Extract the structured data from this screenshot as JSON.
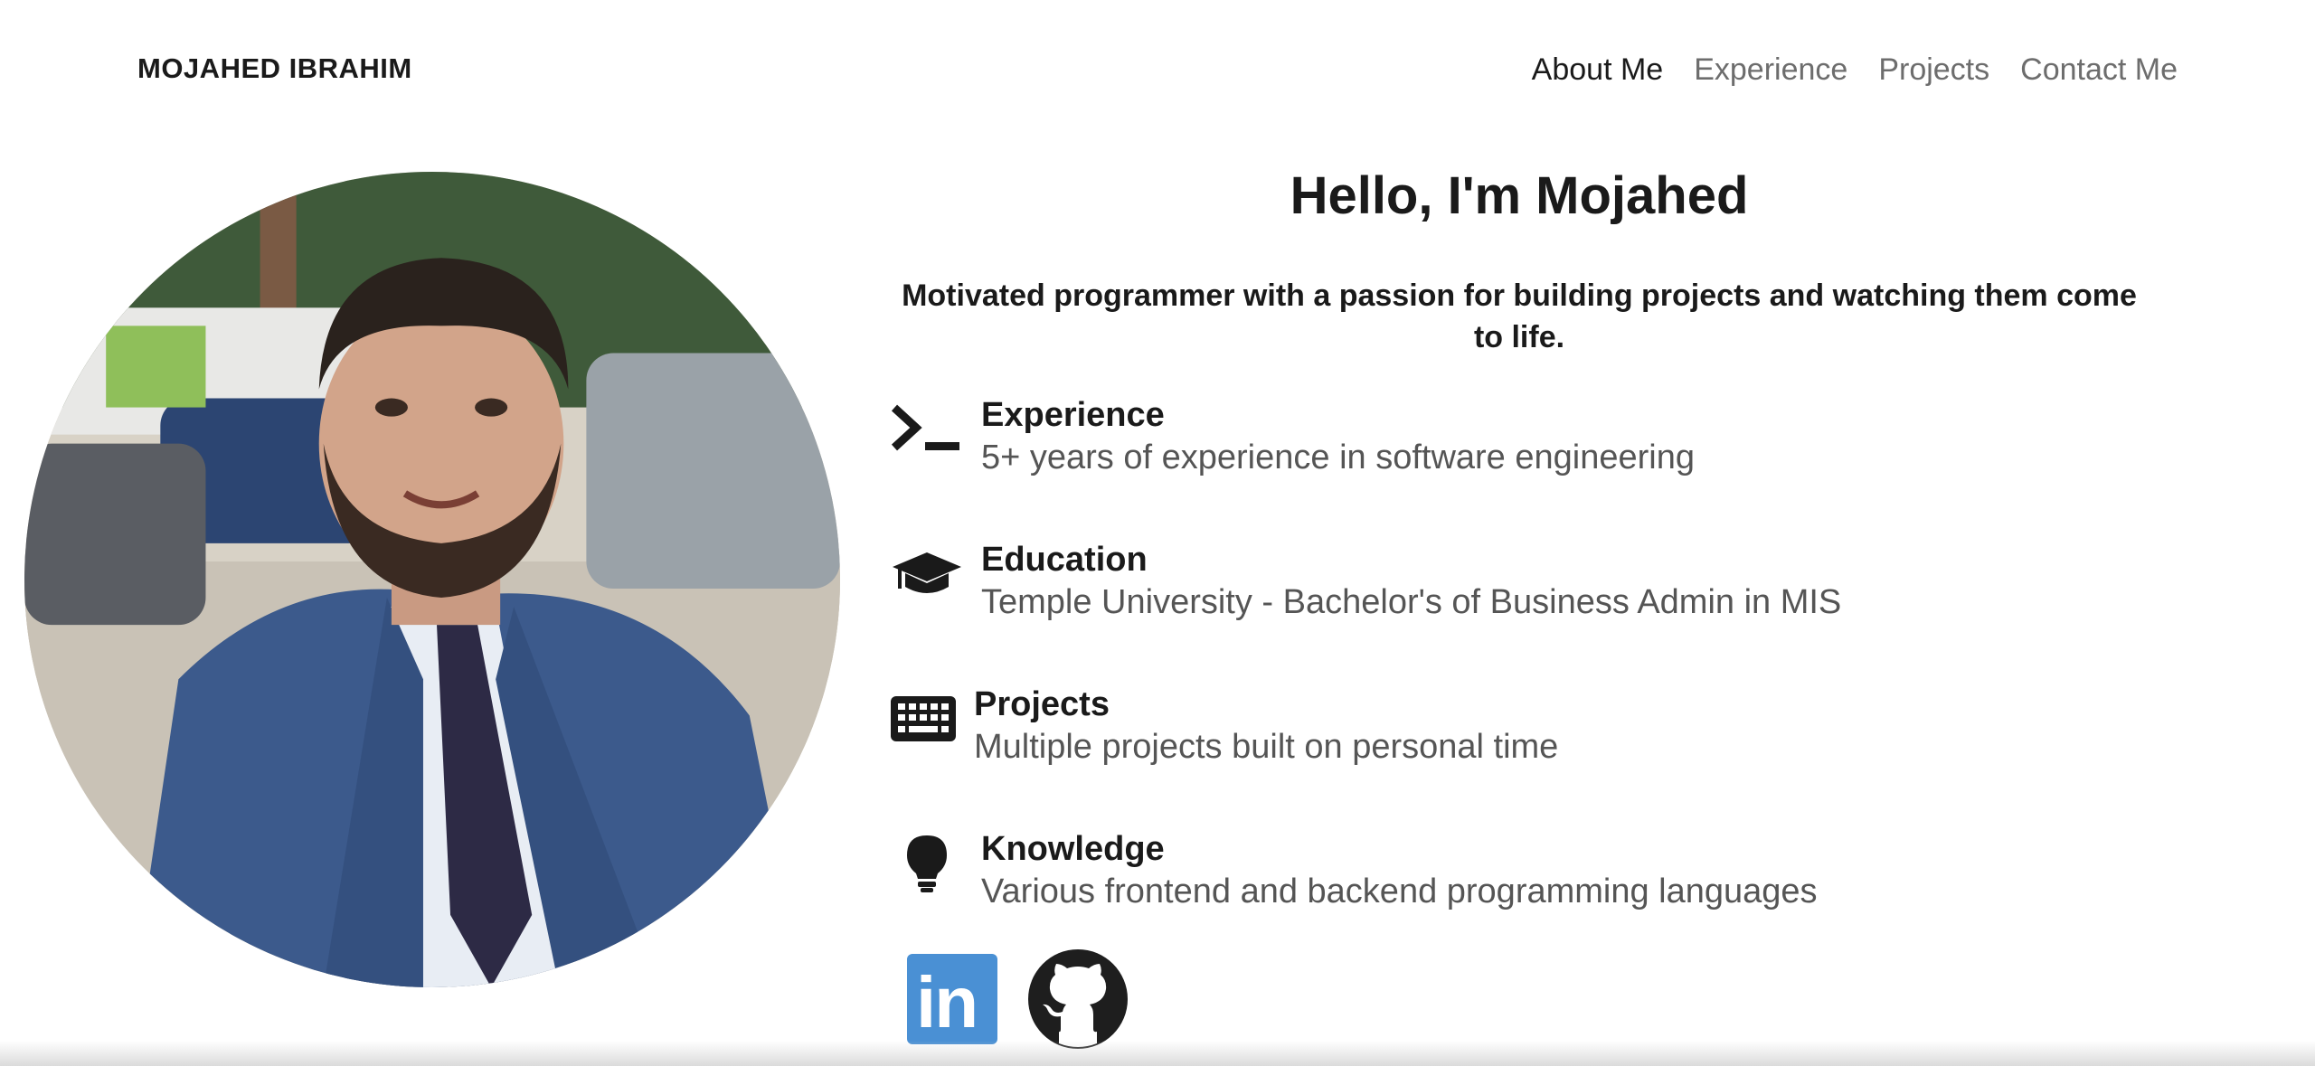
{
  "header": {
    "brand": "MOJAHED IBRAHIM",
    "nav": [
      {
        "label": "About Me",
        "active": true
      },
      {
        "label": "Experience",
        "active": false
      },
      {
        "label": "Projects",
        "active": false
      },
      {
        "label": "Contact Me",
        "active": false
      }
    ]
  },
  "hero": {
    "title": "Hello, I'm Mojahed",
    "subtitle": "Motivated programmer with a passion for building projects and watching them come to life."
  },
  "features": [
    {
      "icon": "terminal-icon",
      "title": "Experience",
      "description": "5+ years of experience in software engineering"
    },
    {
      "icon": "graduation-cap-icon",
      "title": "Education",
      "description": "Temple University - Bachelor's of Business Admin in MIS"
    },
    {
      "icon": "keyboard-icon",
      "title": "Projects",
      "description": "Multiple projects built on personal time"
    },
    {
      "icon": "lightbulb-icon",
      "title": "Knowledge",
      "description": "Various frontend and backend programming languages"
    }
  ],
  "socials": [
    {
      "icon": "linkedin-icon",
      "text": "in"
    },
    {
      "icon": "github-icon"
    }
  ],
  "colors": {
    "text": "#1a1a1a",
    "muted": "#6d6d6d",
    "linkedin": "#4a90d4"
  }
}
